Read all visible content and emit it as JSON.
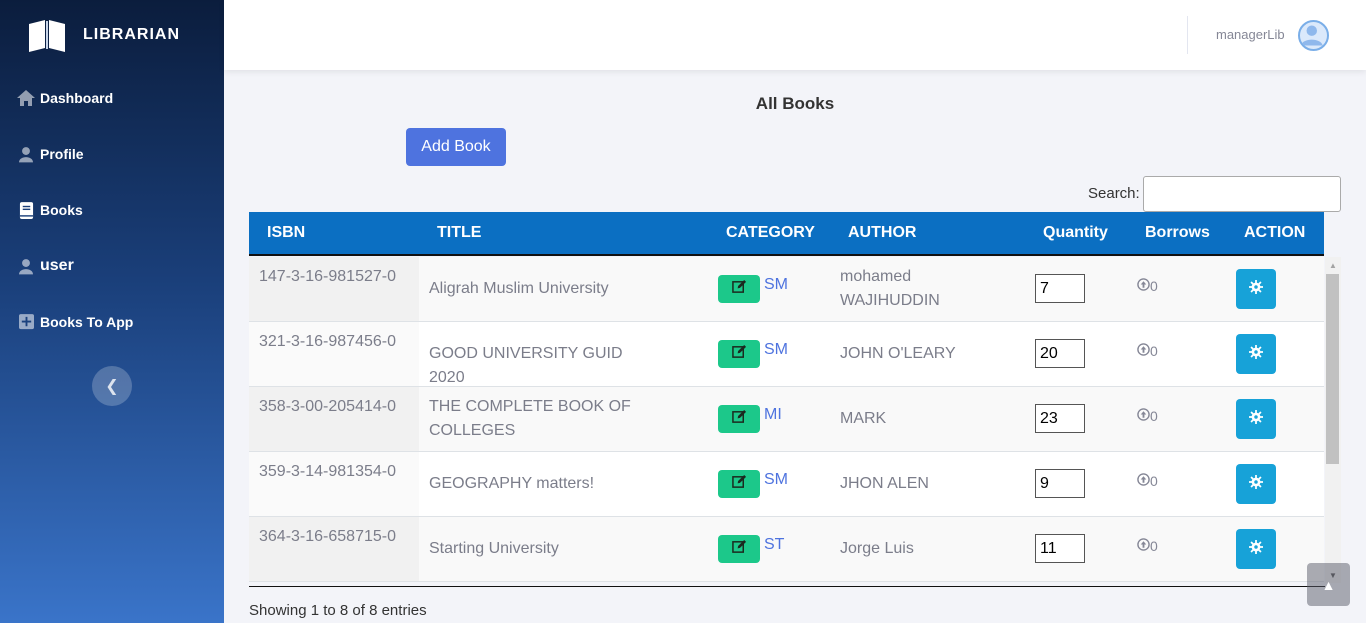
{
  "brand": {
    "name": "LIBRARIAN",
    "icon": "open-book-icon"
  },
  "sidebar": {
    "items": [
      {
        "label": "Dashboard",
        "icon": "home-icon"
      },
      {
        "label": "Profile",
        "icon": "user-icon"
      },
      {
        "label": "Books",
        "icon": "book-icon",
        "active": true
      },
      {
        "label": "user",
        "icon": "user-icon"
      },
      {
        "label": "Books To App",
        "icon": "plus-square-icon"
      }
    ],
    "collapse_icon": "chevron-left-icon"
  },
  "topbar": {
    "username": "managerLib",
    "avatar_icon": "user-avatar-icon"
  },
  "page": {
    "title": "All Books",
    "add_button": "Add Book",
    "search_label": "Search:",
    "search_value": ""
  },
  "table": {
    "headers": [
      "ISBN",
      "TITLE",
      "CATEGORY",
      "AUTHOR",
      "Quantity",
      "Borrows",
      "ACTION"
    ],
    "rows": [
      {
        "isbn": "147-3-16-981527-0",
        "title": "Aligrah Muslim University",
        "category": "SM",
        "author": "mohamed WAJIHUDDIN",
        "quantity": "7",
        "borrows": "0"
      },
      {
        "isbn": "321-3-16-987456-0",
        "title": "GOOD UNIVERSITY GUID 2020",
        "category": "SM",
        "author": "JOHN O'LEARY",
        "quantity": "20",
        "borrows": "0"
      },
      {
        "isbn": "358-3-00-205414-0",
        "title": "THE COMPLETE BOOK OF COLLEGES",
        "category": "MI",
        "author": "MARK",
        "quantity": "23",
        "borrows": "0"
      },
      {
        "isbn": "359-3-14-981354-0",
        "title": "GEOGRAPHY matters!",
        "category": "SM",
        "author": "JHON ALEN",
        "quantity": "9",
        "borrows": "0"
      },
      {
        "isbn": "364-3-16-658715-0",
        "title": "Starting University",
        "category": "ST",
        "author": "Jorge Luis",
        "quantity": "11",
        "borrows": "0"
      }
    ],
    "footer": "Showing 1 to 8 of 8 entries"
  },
  "colors": {
    "header_bg": "#0b6fc2",
    "add_button": "#4e73df",
    "edit_button": "#1cc88a",
    "action_button": "#17a2d8"
  }
}
